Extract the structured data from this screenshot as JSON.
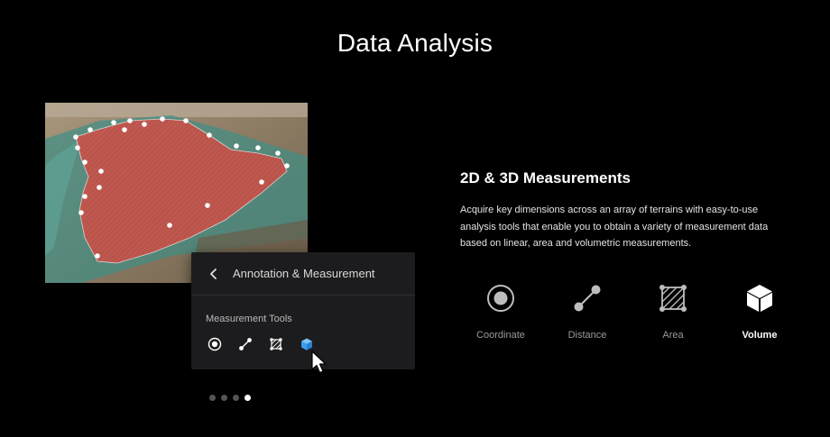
{
  "page": {
    "title": "Data Analysis"
  },
  "map_image": {
    "semantic": "terrain-photo-with-polygon"
  },
  "panel": {
    "title": "Annotation & Measurement",
    "tools_label": "Measurement Tools",
    "tools": [
      {
        "name": "coordinate",
        "icon": "coordinate-icon"
      },
      {
        "name": "distance",
        "icon": "distance-icon"
      },
      {
        "name": "area",
        "icon": "area-icon"
      },
      {
        "name": "volume",
        "icon": "volume-icon",
        "selected": true,
        "color": "#3b9cf0"
      }
    ]
  },
  "pagination": {
    "count": 4,
    "active": 4
  },
  "feature": {
    "title": "2D & 3D Measurements",
    "description": "Acquire key dimensions across an array of terrains with easy-to-use analysis tools that enable you to obtain a variety of measurement data based on linear, area and volumetric measurements."
  },
  "tools": [
    {
      "label": "Coordinate",
      "icon": "coordinate-icon"
    },
    {
      "label": "Distance",
      "icon": "distance-icon"
    },
    {
      "label": "Area",
      "icon": "area-icon"
    },
    {
      "label": "Volume",
      "icon": "volume-icon",
      "active": true
    }
  ],
  "colors": {
    "background": "#000000",
    "panel": "#1c1c1e",
    "accent": "#3b9cf0",
    "polygon": "#e0403a"
  }
}
